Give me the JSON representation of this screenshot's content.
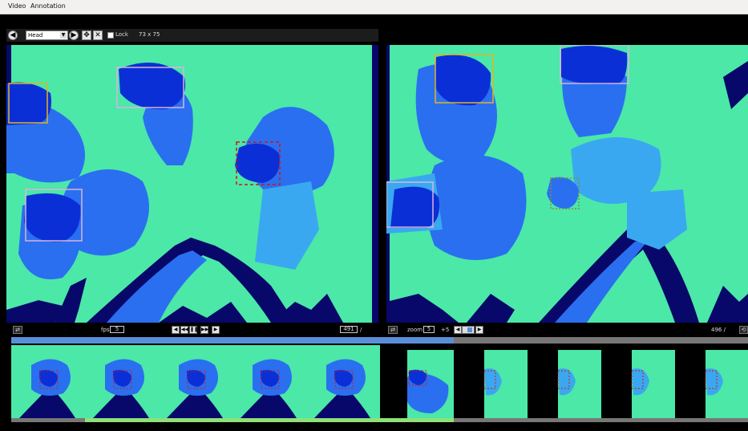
{
  "menu": [
    "Video",
    "Annotation"
  ],
  "toolbar": {
    "label_select": "Head",
    "lock_label": "Lock",
    "size_readout": "73 x 75"
  },
  "left_controls": {
    "fps_label": "fps",
    "fps_value": "5",
    "frame_value": "491",
    "frame_suffix": "/"
  },
  "right_controls": {
    "zoom_label": "zoom",
    "zoom_value": "5",
    "offset_label": "+5",
    "frame_label": "496 /"
  },
  "colors": {
    "background": "#4be8a8",
    "depth_mid": "#2a6ff0",
    "depth_near": "#0b2fd6",
    "depth_shadow": "#07086a",
    "box_orange": "#e6b31e",
    "box_pink": "#d8b4dc",
    "box_red": "#d41414",
    "box_olive": "#8a8a3a"
  },
  "filmstrip": {
    "frames": [
      {
        "bottom_color": "#777777",
        "mode": "normal"
      },
      {
        "bottom_color": "#8fe07a",
        "mode": "normal"
      },
      {
        "bottom_color": "#8fe07a",
        "mode": "normal"
      },
      {
        "bottom_color": "#8fe07a",
        "mode": "normal"
      },
      {
        "bottom_color": "#8fe07a",
        "mode": "normal"
      },
      {
        "bottom_color": "#8fe07a",
        "mode": "zoom"
      },
      {
        "bottom_color": "#777777",
        "mode": "pad"
      },
      {
        "bottom_color": "#777777",
        "mode": "pad"
      },
      {
        "bottom_color": "#777777",
        "mode": "pad"
      },
      {
        "bottom_color": "#777777",
        "mode": "pad"
      }
    ]
  }
}
